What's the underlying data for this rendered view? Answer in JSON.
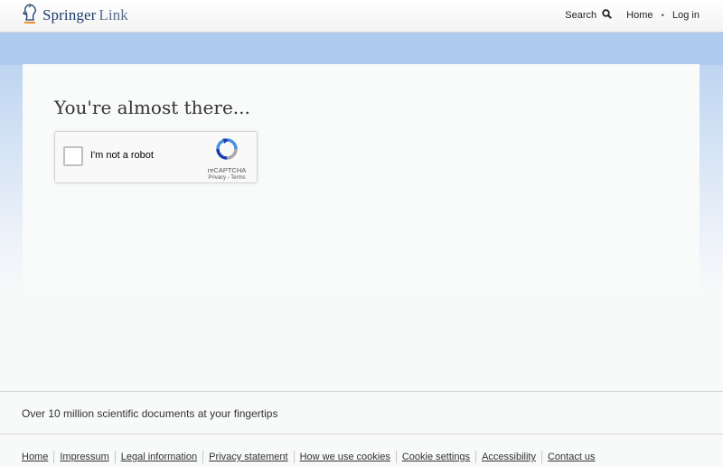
{
  "header": {
    "logo_word": "Springer",
    "logo_suffix": "Link",
    "logo_icon": "springer-horse-icon",
    "nav": {
      "search_label": "Search",
      "search_icon": "search-icon",
      "home_label": "Home",
      "separator": "•",
      "login_label": "Log in"
    }
  },
  "main": {
    "title": "You're almost there...",
    "captcha": {
      "label": "I'm not a robot",
      "brand": "reCAPTCHA",
      "privacy": "Privacy",
      "link_separator": " - ",
      "terms": "Terms",
      "checked": false
    }
  },
  "footer": {
    "tagline": "Over 10 million scientific documents at your fingertips",
    "links": [
      "Home",
      "Impressum",
      "Legal information",
      "Privacy statement",
      "How we use cookies",
      "Cookie settings",
      "Accessibility",
      "Contact us"
    ]
  },
  "colors": {
    "brand_navy": "#1a3a6a",
    "banner_blue": "#b6cfee",
    "recaptcha_blue": "#4a90e2",
    "logo_orange": "#f08c2a"
  }
}
